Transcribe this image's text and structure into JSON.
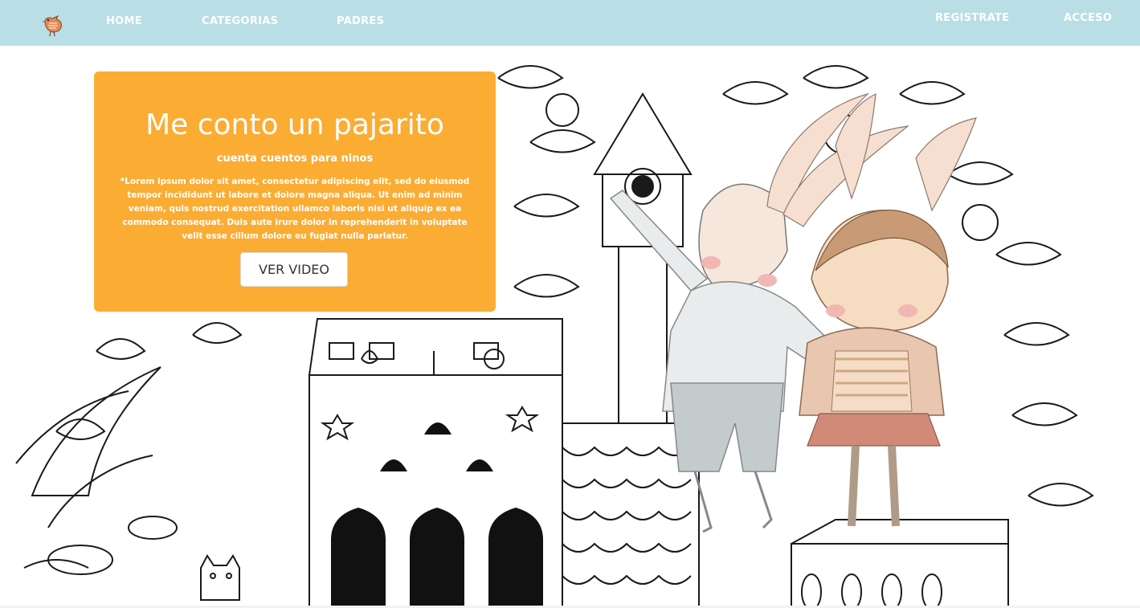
{
  "nav": {
    "brand_icon": "bird-logo-icon",
    "links": [
      {
        "label": "HOME"
      },
      {
        "label": "CATEGORIAS"
      },
      {
        "label": "PADRES"
      }
    ],
    "register_label": "REGISTRATE",
    "login_label": "ACCESO"
  },
  "hero": {
    "title": "Me conto un pajarito",
    "subtitle": "cuenta cuentos para ninos",
    "body": "*Lorem ipsum dolor sit amet, consectetur adipiscing elit, sed do eiusmod tempor incididunt ut labore et dolore magna aliqua. Ut enim ad minim veniam, quis nostrud exercitation ullamco laboris nisi ut aliquip ex ea commodo consequat. Duis aute irure dolor in reprehenderit in voluptate velit esse cillum dolore eu fugiat nulla pariatur.",
    "cta_label": "VER VIDEO",
    "illustration": "coloring-book-treehouse-with-two-bunny-children"
  },
  "colors": {
    "navbar": "#b9dee5",
    "card": "#fbac33",
    "nav_text": "#ffffff"
  }
}
